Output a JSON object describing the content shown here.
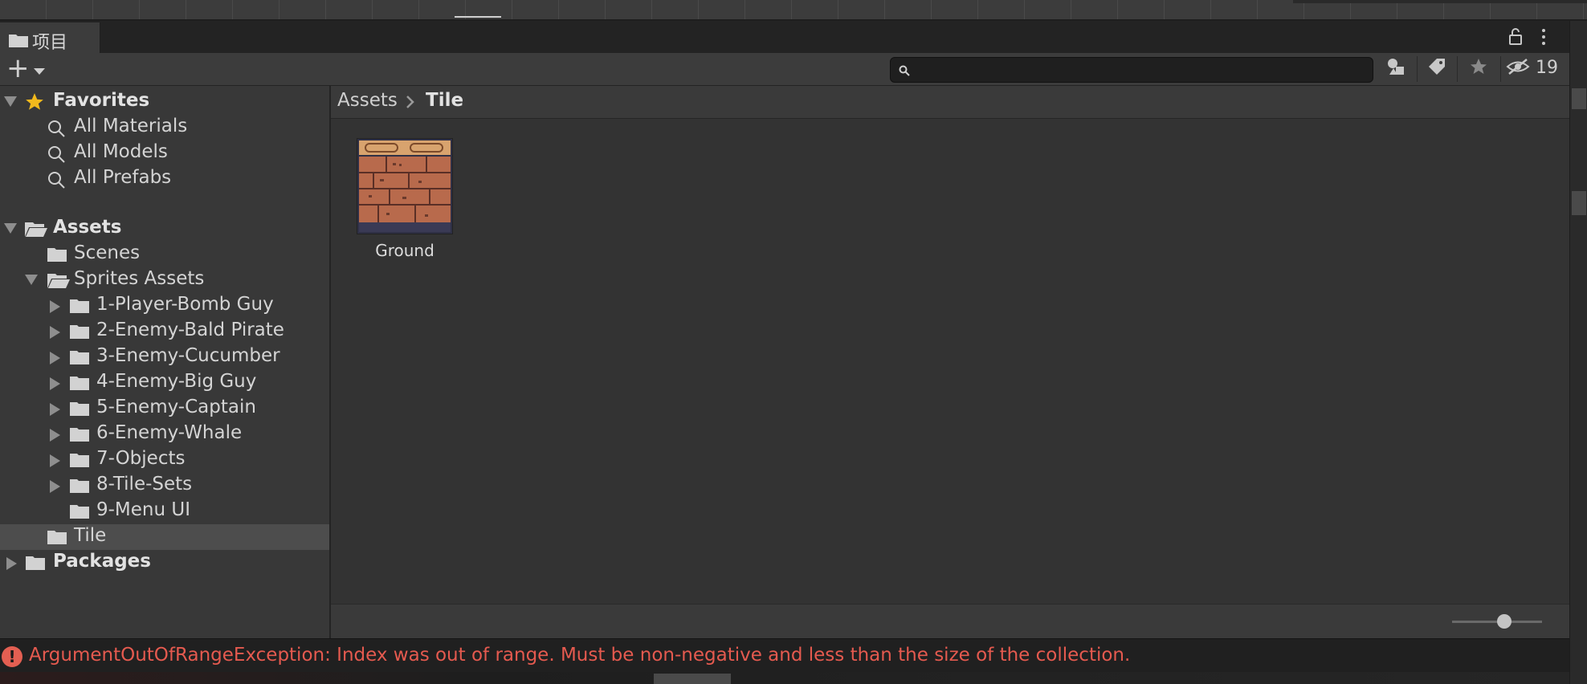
{
  "tab": {
    "label": "项目"
  },
  "toolbar": {
    "search_placeholder": "",
    "hidden_count": "19"
  },
  "breadcrumb": {
    "root": "Assets",
    "current": "Tile"
  },
  "favorites": {
    "label": "Favorites",
    "items": [
      "All Materials",
      "All Models",
      "All Prefabs"
    ]
  },
  "assets_tree": {
    "label": "Assets",
    "scenes": "Scenes",
    "sprites": "Sprites Assets",
    "sprite_children": [
      "1-Player-Bomb Guy",
      "2-Enemy-Bald Pirate",
      "3-Enemy-Cucumber",
      "4-Enemy-Big Guy",
      "5-Enemy-Captain",
      "6-Enemy-Whale",
      "7-Objects",
      "8-Tile-Sets",
      "9-Menu UI"
    ],
    "tile": "Tile"
  },
  "packages": {
    "label": "Packages"
  },
  "content": {
    "asset_name": "Ground"
  },
  "zoom_slider_fraction": 0.6,
  "status": {
    "message": "ArgumentOutOfRangeException: Index was out of range. Must be non-negative and less than the size of the collection.",
    "icon": "!"
  },
  "colors": {
    "error": "#e55a4f",
    "favorite_star": "#f2b91c",
    "selection": "#4d4d4d"
  }
}
